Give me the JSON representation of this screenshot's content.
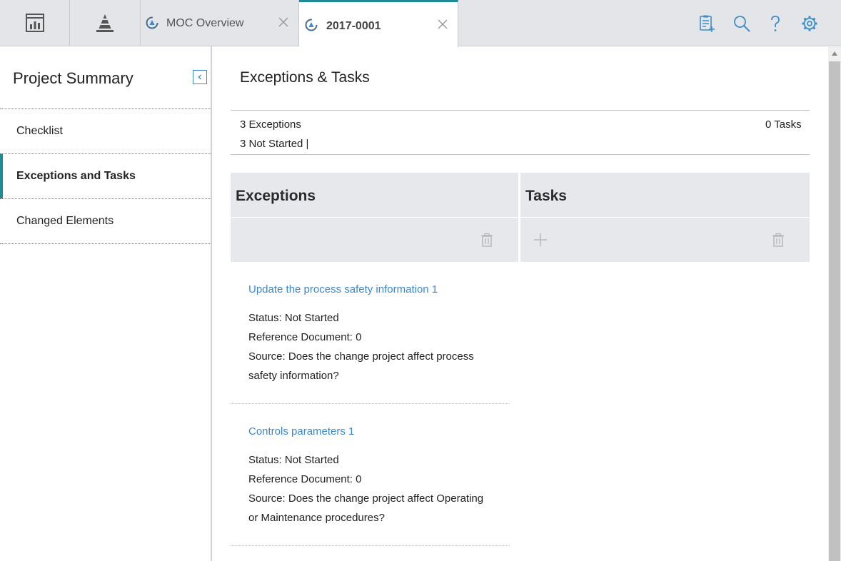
{
  "topbar": {
    "tabs": [
      {
        "label": "MOC Overview",
        "icon": "moc-process-icon"
      },
      {
        "label": "2017-0001",
        "icon": "moc-process-icon",
        "active": true
      }
    ],
    "left_tiles": [
      "dashboard-icon",
      "pyramid-icon"
    ],
    "right_icons": [
      "clipboard-add-icon",
      "search-icon",
      "help-icon",
      "gear-icon"
    ]
  },
  "sidebar": {
    "title": "Project Summary",
    "items": [
      {
        "label": "Checklist"
      },
      {
        "label": "Exceptions and Tasks",
        "active": true
      },
      {
        "label": "Changed Elements"
      }
    ]
  },
  "main": {
    "title": "Exceptions & Tasks",
    "summary": {
      "exceptions_count": "3 Exceptions",
      "tasks_count": "0 Tasks",
      "not_started": "3 Not Started |"
    },
    "exceptions_panel": {
      "title": "Exceptions"
    },
    "tasks_panel": {
      "title": "Tasks"
    },
    "exceptions": [
      {
        "title": "Update the process safety information 1",
        "status": "Status: Not Started",
        "reference": "Reference Document: 0",
        "source_line1": "Source: Does the change project affect process",
        "source_line2": "safety information?"
      },
      {
        "title": "Controls parameters 1",
        "status": "Status: Not Started",
        "reference": "Reference Document: 0",
        "source_line1": "Source: Does the change project affect Operating",
        "source_line2": "or Maintenance procedures?"
      }
    ]
  },
  "colors": {
    "accent": "#1e8a93",
    "link": "#3b87d6",
    "toolbar_icon": "#3a8fc9",
    "panel_bg": "#e7e8eb",
    "topbar_bg": "#e3e5e8"
  }
}
